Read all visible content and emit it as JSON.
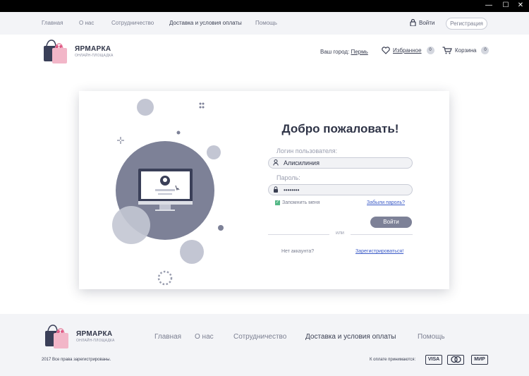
{
  "window": {
    "minimize": "—",
    "maximize": "☐",
    "close": "✕"
  },
  "topnav": {
    "items": [
      "Главная",
      "О нас",
      "Сотрудничество",
      "Доставка и условия оплаты",
      "Помощь"
    ],
    "login": "Войти",
    "register": "Регистрация"
  },
  "logo": {
    "title": "ЯРМАРКА",
    "subtitle": "ОНЛАЙН-ПЛОЩАДКА"
  },
  "header": {
    "city_label": "Ваш город:",
    "city_value": "Пермь",
    "favorites": "Избранное",
    "favorites_count": "0",
    "cart": "Корзина",
    "cart_count": "0"
  },
  "login_form": {
    "title": "Добро пожаловать!",
    "username_label": "Логин пользователя:",
    "username_value": "Алисилиния",
    "password_label": "Пароль:",
    "password_value": "••••••••",
    "remember": "Запомнить меня",
    "forgot": "Забыли пароль?",
    "submit": "Войти",
    "or": "или",
    "no_account": "Нет аккаунта?",
    "register": "Зарегистрироваться!"
  },
  "footer": {
    "items": [
      "Главная",
      "О нас",
      "Сотрудничество",
      "Доставка и условия оплаты",
      "Помощь"
    ],
    "copyright": "2017 Все права зарегистрированы.",
    "payment_label": "К оплате принимаются:",
    "payments": [
      "VISA",
      "MasterCard",
      "МИР"
    ]
  },
  "colors": {
    "accent": "#7d8197",
    "check": "#54b886",
    "link": "#3b5bc7",
    "bag_dark": "#3a3f58",
    "bag_pink": "#f2b6c8"
  }
}
